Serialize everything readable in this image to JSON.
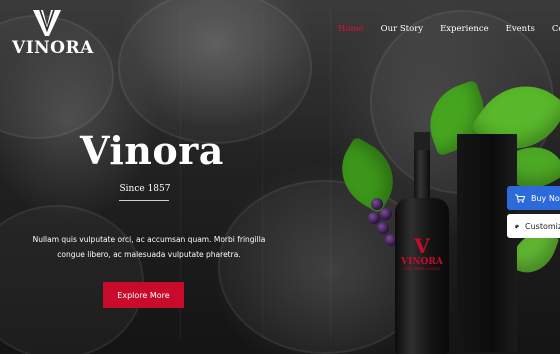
{
  "brand": {
    "logo_letter": "V",
    "name": "VINORA"
  },
  "nav": {
    "items": [
      {
        "label": "Home",
        "active": true
      },
      {
        "label": "Our Story",
        "active": false
      },
      {
        "label": "Experience",
        "active": false
      },
      {
        "label": "Events",
        "active": false
      },
      {
        "label": "Contact",
        "active": false
      }
    ]
  },
  "hero": {
    "title": "Vinora",
    "since": "Since 1857",
    "description": "Nullam quis vulputate orci, ac accumsan quam. Morbi fringilla congue libero, ac malesuada vulputate pharetra.",
    "cta_label": "Explore More"
  },
  "product": {
    "bottle_mark": "V",
    "bottle_name": "VINORA",
    "bottle_subtitle": "FINE WINE HOUSE"
  },
  "floating": {
    "buy_label": "Buy Now",
    "customize_label": "Customize"
  },
  "colors": {
    "accent": "#e00f35",
    "button_red": "#c80a2b",
    "buy_blue": "#2b6ad8"
  },
  "icons": {
    "cart": "cart-icon",
    "palette": "palette-icon"
  }
}
